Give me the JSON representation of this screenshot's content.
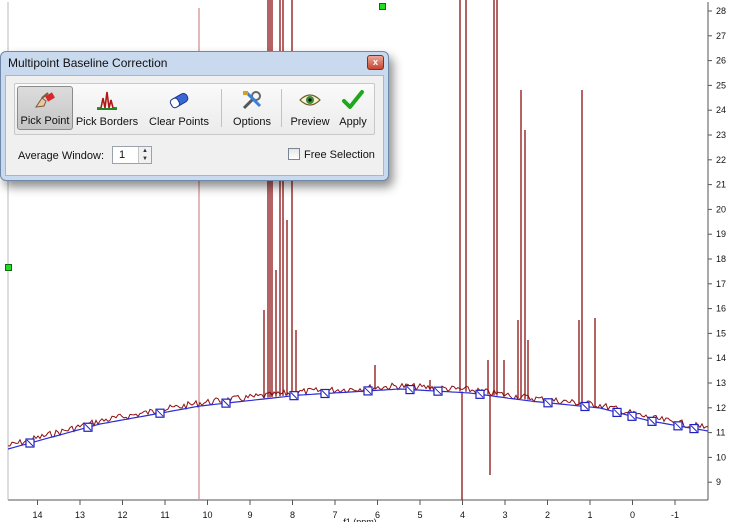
{
  "dialog": {
    "title": "Multipoint Baseline Correction",
    "close_glyph": "x",
    "toolbar": [
      {
        "id": "pick-point",
        "label": "Pick Point",
        "icon": "hand-pointer-icon",
        "active": true
      },
      {
        "id": "pick-borders",
        "label": "Pick Borders",
        "icon": "peaks-icon",
        "active": false
      },
      {
        "id": "clear-points",
        "label": "Clear Points",
        "icon": "eraser-icon",
        "active": false
      },
      {
        "id": "options",
        "label": "Options",
        "icon": "tools-icon",
        "active": false
      },
      {
        "id": "preview",
        "label": "Preview",
        "icon": "eye-icon",
        "active": false
      },
      {
        "id": "apply",
        "label": "Apply",
        "icon": "checkmark-icon",
        "active": false
      }
    ],
    "average_window_label": "Average Window:",
    "average_window_value": "1",
    "free_selection_label": "Free Selection",
    "free_selection_checked": false
  },
  "spectrum": {
    "x_ticks": [
      "14",
      "13",
      "12",
      "11",
      "10",
      "9",
      "8",
      "7",
      "6",
      "5",
      "4",
      "3",
      "2",
      "1",
      "0",
      "-1"
    ],
    "x_axis_label_partial": "f1 (ppm)",
    "y_ticks": [
      "28",
      "27",
      "26",
      "25",
      "24",
      "23",
      "22",
      "21",
      "20",
      "19",
      "18",
      "17",
      "16",
      "15",
      "14",
      "13",
      "12",
      "11",
      "10",
      "9"
    ],
    "colors": {
      "spectrum": "#8b1010",
      "baseline": "#2b2bd8",
      "marker": "#1f1fbf",
      "cursor": "#c87070",
      "handle": "#22dd22"
    }
  }
}
